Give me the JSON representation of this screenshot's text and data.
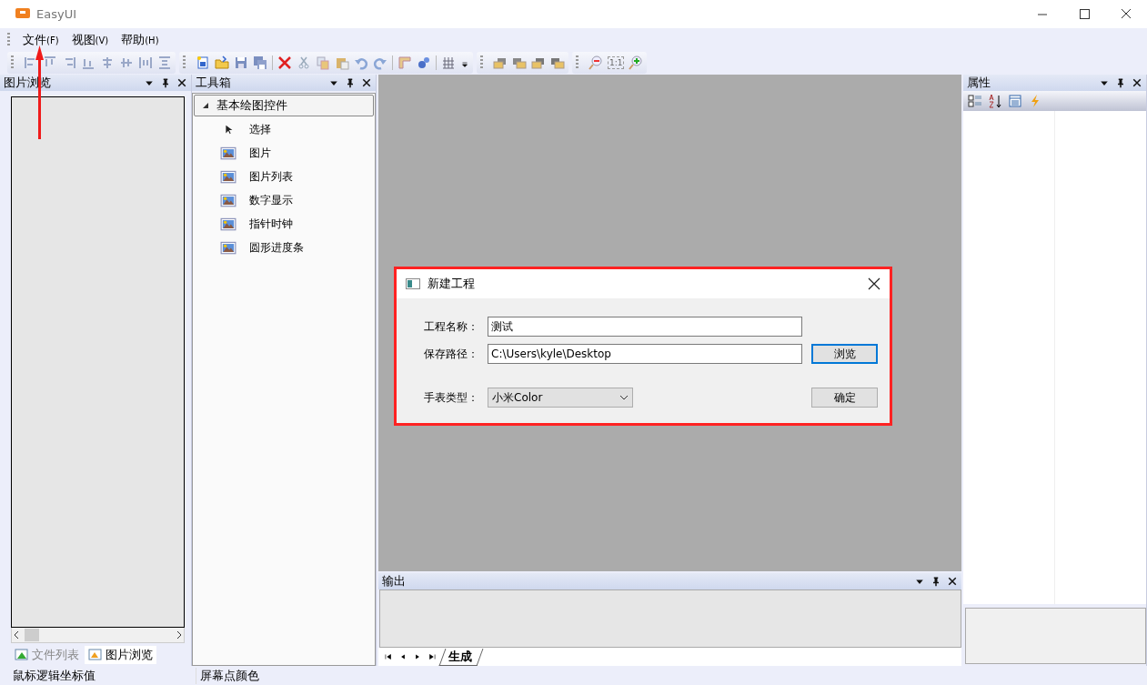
{
  "window": {
    "title": "EasyUI"
  },
  "menu": [
    {
      "label": "文件",
      "accel": "(F)"
    },
    {
      "label": "视图",
      "accel": "(V)"
    },
    {
      "label": "帮助",
      "accel": "(H)"
    }
  ],
  "toolbar": {
    "zoom_reset": "1:1"
  },
  "left_panel": {
    "title": "图片浏览",
    "tabs": [
      {
        "label": "文件列表",
        "selected": false
      },
      {
        "label": "图片浏览",
        "selected": true
      }
    ]
  },
  "toolbox": {
    "title": "工具箱",
    "groups": [
      {
        "label": "基本绘图控件",
        "expanded": true,
        "items": [
          {
            "label": "选择",
            "kind": "pointer"
          },
          {
            "label": "图片",
            "kind": "image"
          },
          {
            "label": "图片列表",
            "kind": "image"
          },
          {
            "label": "数字显示",
            "kind": "image"
          },
          {
            "label": "指针时钟",
            "kind": "image"
          },
          {
            "label": "圆形进度条",
            "kind": "image"
          }
        ]
      }
    ]
  },
  "properties": {
    "title": "属性"
  },
  "output": {
    "title": "输出",
    "tabs": [
      {
        "label": "生成",
        "selected": true
      }
    ]
  },
  "dialog": {
    "title": "新建工程",
    "fields": [
      {
        "label": "工程名称：",
        "value": "测试"
      },
      {
        "label": "保存路径：",
        "value": "C:\\Users\\kyle\\Desktop"
      }
    ],
    "browse_button": "浏览",
    "watch_type": {
      "label": "手表类型：",
      "value": "小米Color"
    },
    "ok_button": "确定"
  },
  "status_bar": [
    "鼠标逻辑坐标值",
    "屏幕点颜色"
  ]
}
